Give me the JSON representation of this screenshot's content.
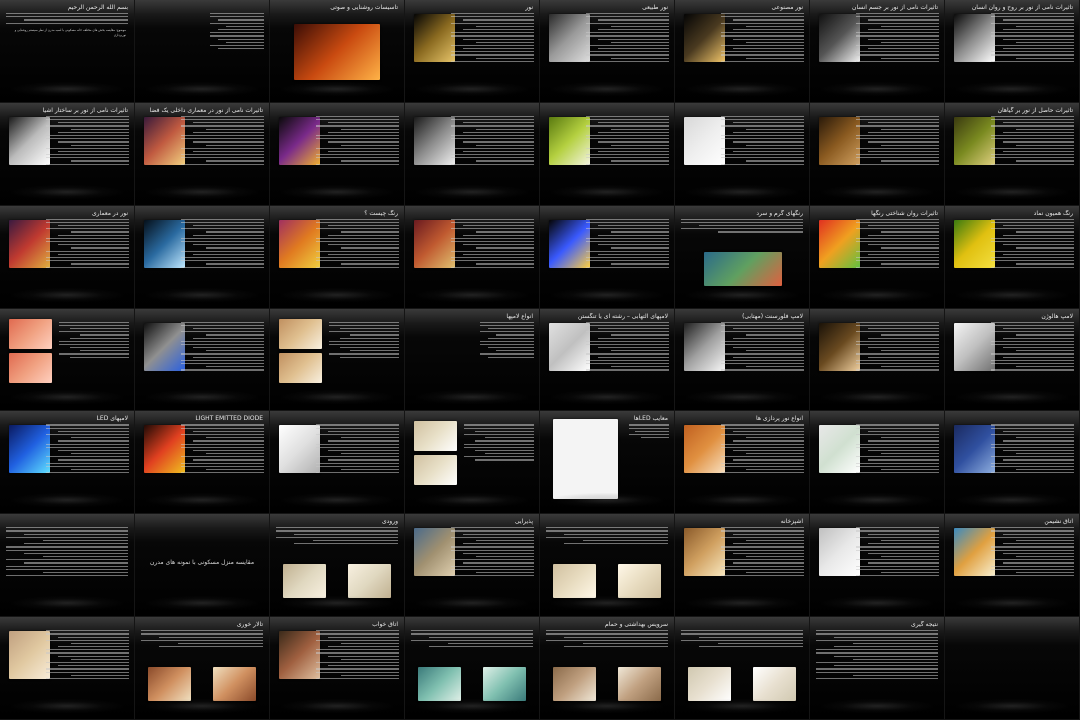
{
  "slides": [
    {
      "title": "بسم الله الرحمن الرحیم",
      "body": "موضوع: مقایسه بخش های مختلف خانه مسکونی با اسبه مدرن از نظر سیستم روشنایی و نورپردازی",
      "layout": "text"
    },
    {
      "title": "",
      "layout": "list"
    },
    {
      "title": "تاسیسات روشنایی و صوتی",
      "layout": "titleimg",
      "img": [
        "#3b0d06",
        "#c94a10",
        "#ffb347"
      ]
    },
    {
      "title": "نور",
      "layout": "imgleft",
      "img": [
        "#050505",
        "#8a6a20",
        "#e7c56a"
      ]
    },
    {
      "title": "نور طبیعی",
      "layout": "imgleft",
      "img": [
        "#2a2a2a",
        "#9a9a9a",
        "#dedede"
      ]
    },
    {
      "title": "نور مصنوعی",
      "layout": "imgleft",
      "img": [
        "#050505",
        "#4a3a20",
        "#f2c66a"
      ]
    },
    {
      "title": "تاثیرات نامی از نور بر جسم انسان",
      "layout": "imgleft",
      "img": [
        "#111",
        "#555",
        "#f2f2f2"
      ]
    },
    {
      "title": "تاثیرات نامی از نور بر روح و روان انسان",
      "layout": "imgleft",
      "img": [
        "#0a0a0a",
        "#8c8c8c",
        "#ffffff"
      ]
    },
    {
      "title": "تاثیرات نامی از نور بر ساختار اشیا",
      "layout": "imgleft",
      "img": [
        "#1a1a1a",
        "#bbbbbb",
        "#ffffff"
      ]
    },
    {
      "title": "تاثیرات نامی از نور در معماری داخلی یک فضا",
      "layout": "imgleft",
      "img": [
        "#3a1a3a",
        "#c05a40",
        "#f2d080"
      ]
    },
    {
      "title": "",
      "layout": "imgleft",
      "img": [
        "#0a0a0a",
        "#7a2a8a",
        "#f0b030"
      ]
    },
    {
      "title": "",
      "layout": "imgleft",
      "img": [
        "#1a1a1a",
        "#8c8c8c",
        "#f0f0f0"
      ]
    },
    {
      "title": "",
      "layout": "imgleft",
      "img": [
        "#5a7a10",
        "#b4d040",
        "#f4f4e0"
      ]
    },
    {
      "title": "",
      "layout": "imgleft",
      "img": [
        "#d8d8d8",
        "#eeeeee",
        "#ffffff"
      ]
    },
    {
      "title": "",
      "layout": "imgleft",
      "img": [
        "#2a1a0a",
        "#8a5a20",
        "#d0a060"
      ]
    },
    {
      "title": "تاثیرات حاصل از نور بر گیاهان",
      "layout": "imgleft",
      "img": [
        "#3a3a10",
        "#7a8a20",
        "#e0d080"
      ]
    },
    {
      "title": "نور در معماری",
      "layout": "imgleft",
      "img": [
        "#3a1a40",
        "#c03a30",
        "#e0b040"
      ]
    },
    {
      "title": "",
      "layout": "imgleft",
      "img": [
        "#05101a",
        "#2a6aa0",
        "#c0e8ff"
      ]
    },
    {
      "title": "رنگ چیست ؟",
      "layout": "imgleft",
      "img": [
        "#a03060",
        "#e07a20",
        "#f0d040"
      ]
    },
    {
      "title": "",
      "layout": "imgleft",
      "img": [
        "#6a1a20",
        "#c05a30",
        "#e0c070"
      ]
    },
    {
      "title": "",
      "layout": "imgleft",
      "img": [
        "#050505",
        "#3a5aff",
        "#ffd040"
      ]
    },
    {
      "title": "رنگهای گرم و سرد",
      "layout": "imgbottom",
      "img": [
        "#2a6a8a",
        "#60a060",
        "#e06040"
      ]
    },
    {
      "title": "تاثیرات روان شناختی رنگها",
      "layout": "imgleft",
      "img": [
        "#e03020",
        "#f0a020",
        "#60c040"
      ]
    },
    {
      "title": "رنگ همیون نماد",
      "layout": "imgleft",
      "img": [
        "#3a7a10",
        "#e0c010",
        "#f4e040"
      ]
    },
    {
      "title": "",
      "layout": "imgleft2",
      "img": [
        "#e06a50",
        "#f0a080",
        "#ffd0c0"
      ]
    },
    {
      "title": "",
      "layout": "imgleft",
      "img": [
        "#101010",
        "#909090",
        "#2a60e0"
      ]
    },
    {
      "title": "",
      "layout": "imgleft2",
      "img": [
        "#c09060",
        "#e0c090",
        "#f8f0e0"
      ]
    },
    {
      "title": "انواع لامپها",
      "layout": "list"
    },
    {
      "title": "لامپهای التهابی – رشته ای یا تنگستن",
      "layout": "imgleft",
      "img": [
        "#e0e0e0",
        "#c0c0c0",
        "#ffffff"
      ]
    },
    {
      "title": "لامپ فلورسنت (مهتابی)",
      "layout": "imgleft",
      "img": [
        "#202020",
        "#a0a0a0",
        "#f8f8f8"
      ]
    },
    {
      "title": "",
      "layout": "imgleft",
      "img": [
        "#1a1208",
        "#6a4a20",
        "#f0d0a0"
      ]
    },
    {
      "title": "لامپ هالوژن",
      "layout": "imgleft",
      "img": [
        "#f4f4f4",
        "#c0c0c0",
        "#707070"
      ]
    },
    {
      "title": "لامپهای LED",
      "layout": "imgleft",
      "img": [
        "#0a1a60",
        "#2060e0",
        "#60e0ff"
      ]
    },
    {
      "title": "LIGHT EMITTED DIODE",
      "layout": "imgleft",
      "img": [
        "#200a05",
        "#e04020",
        "#f0c020"
      ]
    },
    {
      "title": "",
      "layout": "imgleft",
      "img": [
        "#ffffff",
        "#e0e0e0",
        "#b0b0b0"
      ]
    },
    {
      "title": "",
      "layout": "imgleft2",
      "img": [
        "#d0c0a0",
        "#e8e0c8",
        "#ffffff"
      ]
    },
    {
      "title": "معایب LEDها",
      "layout": "table"
    },
    {
      "title": "انواع نور پردازی ها",
      "layout": "imgleft",
      "img": [
        "#c06020",
        "#e09040",
        "#f8e0c0"
      ]
    },
    {
      "title": "",
      "layout": "imgleft",
      "img": [
        "#e8e8e8",
        "#d0e0d0",
        "#ffffff"
      ]
    },
    {
      "title": "",
      "layout": "imgleft",
      "img": [
        "#1a2a60",
        "#3050a0",
        "#90b0e0"
      ]
    },
    {
      "title": "",
      "layout": "text"
    },
    {
      "title": "",
      "layout": "center",
      "body": "مقایسه منزل مسکونی با نمونه های مدرن"
    },
    {
      "title": "ورودی",
      "layout": "twoimg",
      "img": [
        "#c0b090",
        "#e0d8c0",
        "#f8f0e0"
      ]
    },
    {
      "title": "پذیرایی",
      "layout": "imgleft",
      "img": [
        "#4a6a8a",
        "#a09070",
        "#e0d0b0"
      ]
    },
    {
      "title": "",
      "layout": "twoimg",
      "img": [
        "#d0c0a0",
        "#e8dcc0",
        "#fff8e8"
      ]
    },
    {
      "title": "آشپزخانه",
      "layout": "imgleft",
      "img": [
        "#8a5a2a",
        "#d0a060",
        "#f8e8c0"
      ]
    },
    {
      "title": "",
      "layout": "imgleft",
      "img": [
        "#c0c0c0",
        "#e8e8e8",
        "#ffffff"
      ]
    },
    {
      "title": "اتاق نشیمن",
      "layout": "imgleft",
      "img": [
        "#3a8ac0",
        "#e0a040",
        "#f8f0d0"
      ]
    },
    {
      "title": "",
      "layout": "imgleft",
      "img": [
        "#c0a080",
        "#e0c8a0",
        "#f8ecd8"
      ]
    },
    {
      "title": "تالار خوری",
      "layout": "twoimg",
      "img": [
        "#8a4a2a",
        "#d09060",
        "#f0e0c0"
      ]
    },
    {
      "title": "اتاق خواب",
      "layout": "imgleft",
      "img": [
        "#3a2a1a",
        "#a06040",
        "#e0c0a0"
      ]
    },
    {
      "title": "",
      "layout": "twoimg",
      "img": [
        "#3a7a7a",
        "#80c0b0",
        "#e0f0e8"
      ]
    },
    {
      "title": "سرویس بهداشتی و حمام",
      "layout": "twoimg",
      "img": [
        "#8a6a4a",
        "#c0a080",
        "#f0e8d8"
      ]
    },
    {
      "title": "",
      "layout": "twoimg",
      "img": [
        "#d0c8b0",
        "#e8e0d0",
        "#ffffff"
      ]
    },
    {
      "title": "نتیجه گیری",
      "layout": "text"
    },
    {
      "title": "",
      "layout": "blank"
    }
  ]
}
